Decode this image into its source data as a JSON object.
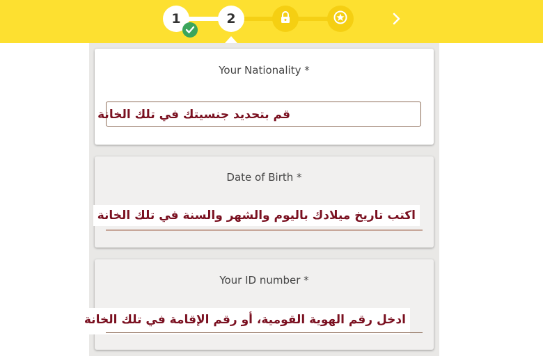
{
  "stepper": {
    "steps": [
      {
        "label": "1",
        "state": "completed",
        "icon": "check-icon"
      },
      {
        "label": "2",
        "state": "current"
      },
      {
        "label": "",
        "state": "locked",
        "icon": "lock-icon"
      },
      {
        "label": "",
        "state": "locked",
        "icon": "star-icon"
      }
    ],
    "next_icon": "chevron-right-icon"
  },
  "form": {
    "nationality": {
      "label": "Your Nationality *",
      "hint": "قم بتحديد جنسيتك في تلك الخانة"
    },
    "dob": {
      "label": "Date of Birth *",
      "hint": "اكتب تاريخ ميلادك باليوم والشهر والسنة في تلك الخانة"
    },
    "id_number": {
      "label": "Your ID number *",
      "hint": "ادخل رقم الهوية القومية، أو رقم الإقامة في تلك الخانة"
    }
  },
  "colors": {
    "header": "#fde030",
    "check": "#3ba55c",
    "hint_text": "#7a1020"
  }
}
